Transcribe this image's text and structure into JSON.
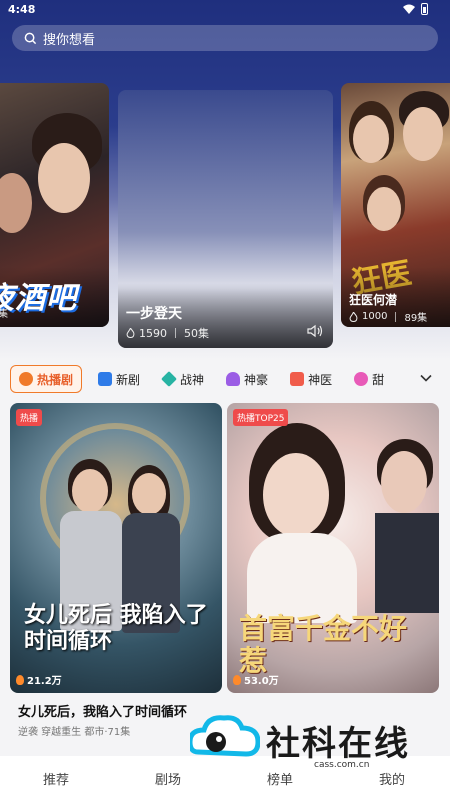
{
  "status": {
    "time": "4:48"
  },
  "search": {
    "placeholder": "搜你想看"
  },
  "carousel": {
    "left": {
      "big_text": "夜酒吧",
      "meta": "集"
    },
    "center": {
      "title": "一步登天",
      "plays": "1590",
      "episodes": "50集"
    },
    "right": {
      "title": "狂医何潜",
      "plays": "1000",
      "episodes": "89集",
      "art_text": "狂医"
    }
  },
  "tabs": [
    {
      "label": "热播剧",
      "icon": "fire-icon",
      "color": "#f07a2a",
      "active": true
    },
    {
      "label": "新剧",
      "icon": "play-square-icon",
      "color": "#2e7be8",
      "active": false
    },
    {
      "label": "战神",
      "icon": "crossed-swords-icon",
      "color": "#27b3a3",
      "active": false
    },
    {
      "label": "神豪",
      "icon": "person-icon",
      "color": "#9b5de5",
      "active": false
    },
    {
      "label": "神医",
      "icon": "medical-kit-icon",
      "color": "#f05c4b",
      "active": false
    },
    {
      "label": "甜",
      "icon": "heart-icon",
      "color": "#e85ab8",
      "active": false
    }
  ],
  "grid": [
    {
      "badge": "热播",
      "plays": "21.2万",
      "art_text": "女儿死后 我陷入了时间循环",
      "title": "女儿死后，我陷入了时间循环",
      "tags": "逆袭 穿越重生 都市·71集"
    },
    {
      "badge": "热播TOP25",
      "plays": "53.0万",
      "art_text": "首富千金不好惹"
    }
  ],
  "bottom_nav": [
    {
      "label": "推荐"
    },
    {
      "label": "剧场"
    },
    {
      "label": "榜单"
    },
    {
      "label": "我的"
    }
  ],
  "watermark": {
    "text": "社科在线",
    "url": "cass.com.cn"
  }
}
